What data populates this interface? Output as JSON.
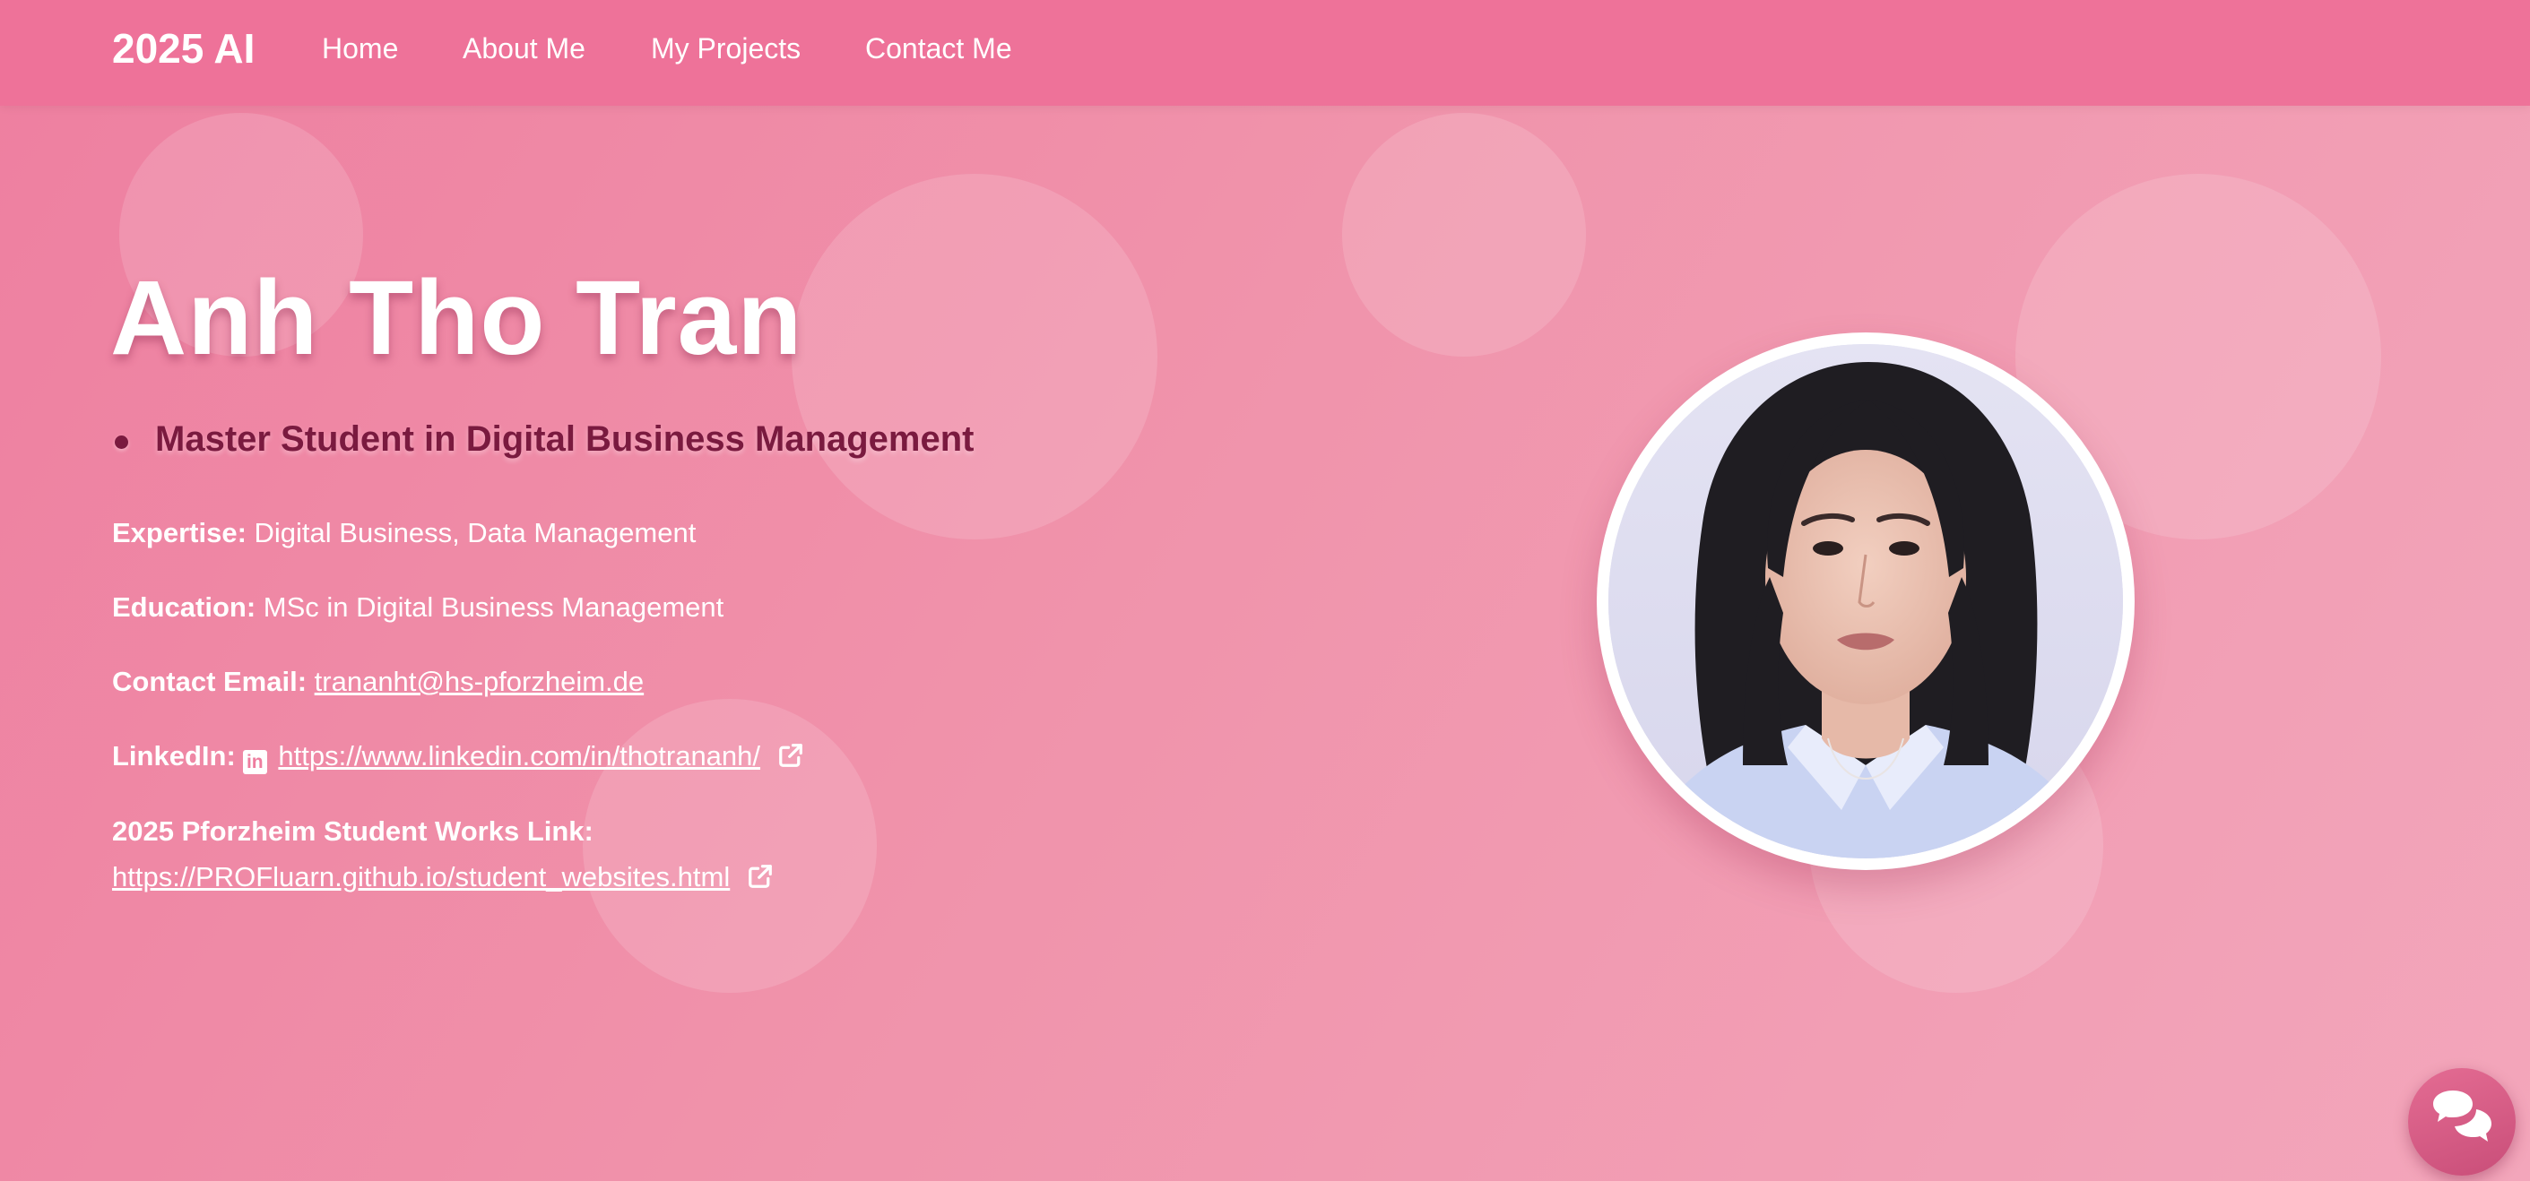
{
  "nav": {
    "brand": "2025 AI",
    "links": [
      "Home",
      "About Me",
      "My Projects",
      "Contact Me"
    ]
  },
  "hero": {
    "name": "Anh Tho Tran",
    "subtitle": "Master Student in Digital Business Management",
    "expertise_label": "Expertise:",
    "expertise_value": "Digital Business, Data Management",
    "education_label": "Education:",
    "education_value": "MSc in Digital Business Management",
    "email_label": "Contact Email:",
    "email_value": "trananht@hs-pforzheim.de",
    "linkedin_label": "LinkedIn:",
    "linkedin_value": "https://www.linkedin.com/in/thotrananh/",
    "works_label": "2025 Pforzheim Student Works Link:",
    "works_value": "https://PROFluarn.github.io/student_websites.html"
  },
  "icons": {
    "linkedin": "linkedin-icon",
    "external_link": "external-link-icon",
    "chat": "chat-bubbles-icon"
  },
  "colors": {
    "navbar": "#ee7299",
    "background": "#f093ab",
    "subtitle": "#7a1a3f",
    "chat_button": "#d45a84"
  }
}
